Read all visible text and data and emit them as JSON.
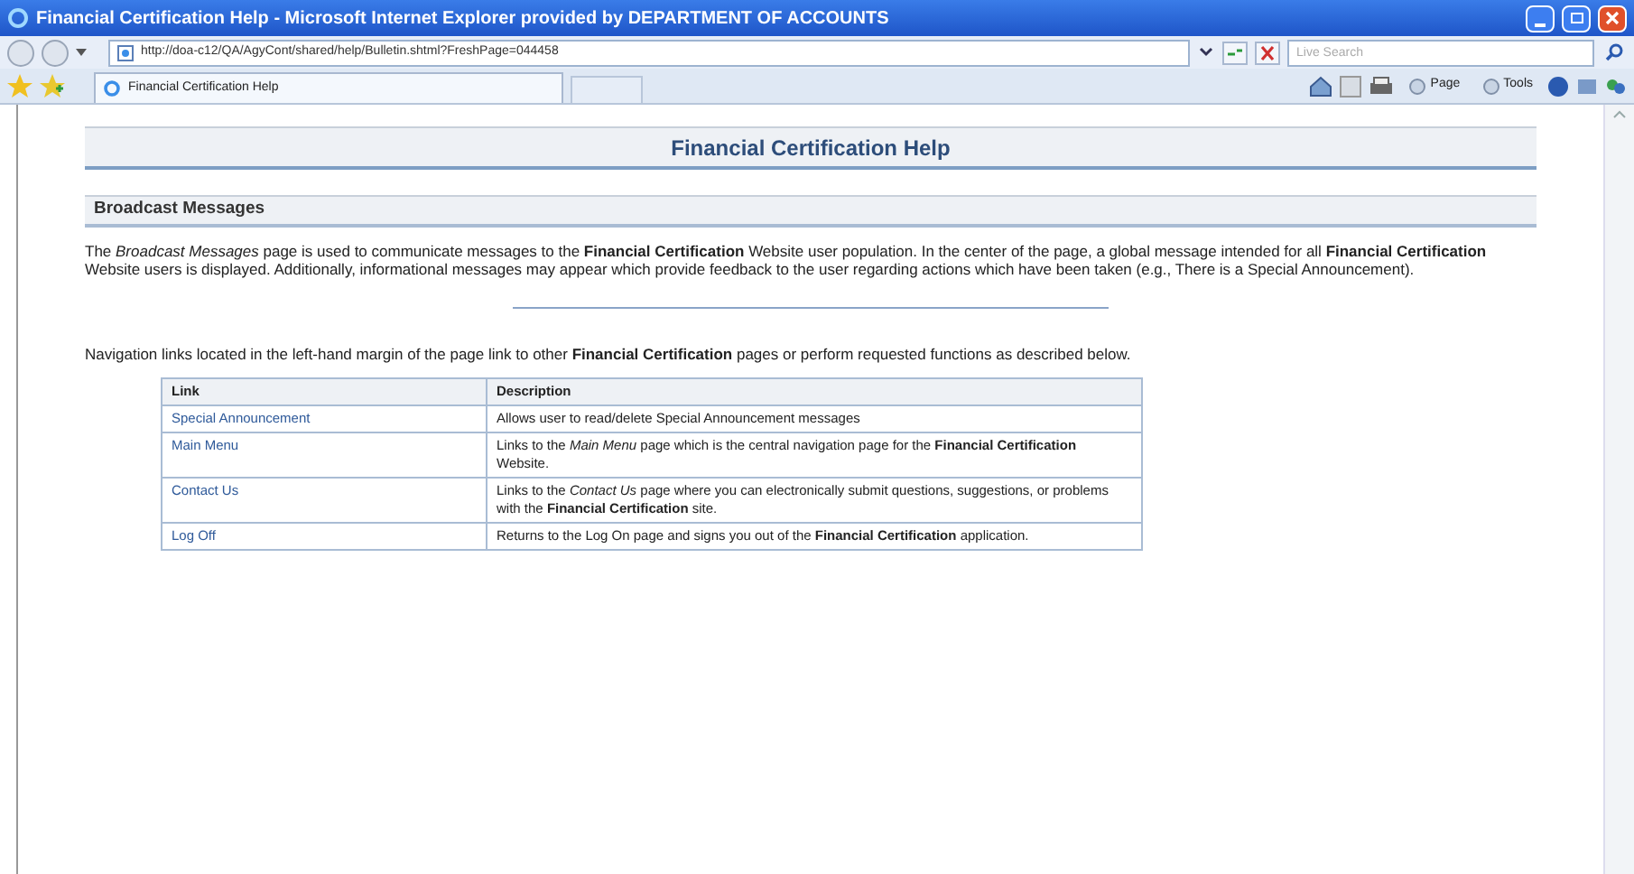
{
  "window": {
    "title": "Financial Certification Help - Microsoft Internet Explorer provided by DEPARTMENT OF ACCOUNTS"
  },
  "address_bar": {
    "url": "http://doa-c12/QA/AgyCont/shared/help/Bulletin.shtml?FreshPage=044458"
  },
  "search": {
    "placeholder": "Live Search"
  },
  "tab": {
    "title": "Financial Certification Help"
  },
  "command_bar": [
    {
      "label": "Page"
    },
    {
      "label": "Tools"
    }
  ],
  "page": {
    "title": "Financial Certification Help",
    "section": "Broadcast Messages",
    "intro": "The *Broadcast Messages* page is used to communicate messages to the **Financial Certification** Website user population. In the center of the page, a global message intended for all **Financial Certification** Website users is displayed. Additionally, informational messages may appear which provide feedback to the user regarding actions which have been taken (e.g., There is a Special Announcement).",
    "nav_text": "Navigation links located in the left-hand margin of the page link to other **Financial Certification** pages or perform requested functions as described below.",
    "table": {
      "columns": [
        "Link",
        "Description"
      ],
      "rows": [
        {
          "link": "Special Announcement",
          "description": "Allows user to read/delete Special Announcement messages"
        },
        {
          "link": "Main Menu",
          "description": "Links to the *Main Menu* page which is the central navigation page for the **Financial Certification** Website."
        },
        {
          "link": "Contact Us",
          "description": "Links to the *Contact Us* page where you can electronically submit questions, suggestions, or problems with the **Financial Certification** site."
        },
        {
          "link": "Log Off",
          "description": "Returns to the Log On page and signs you out of the **Financial Certification** application."
        }
      ]
    }
  }
}
